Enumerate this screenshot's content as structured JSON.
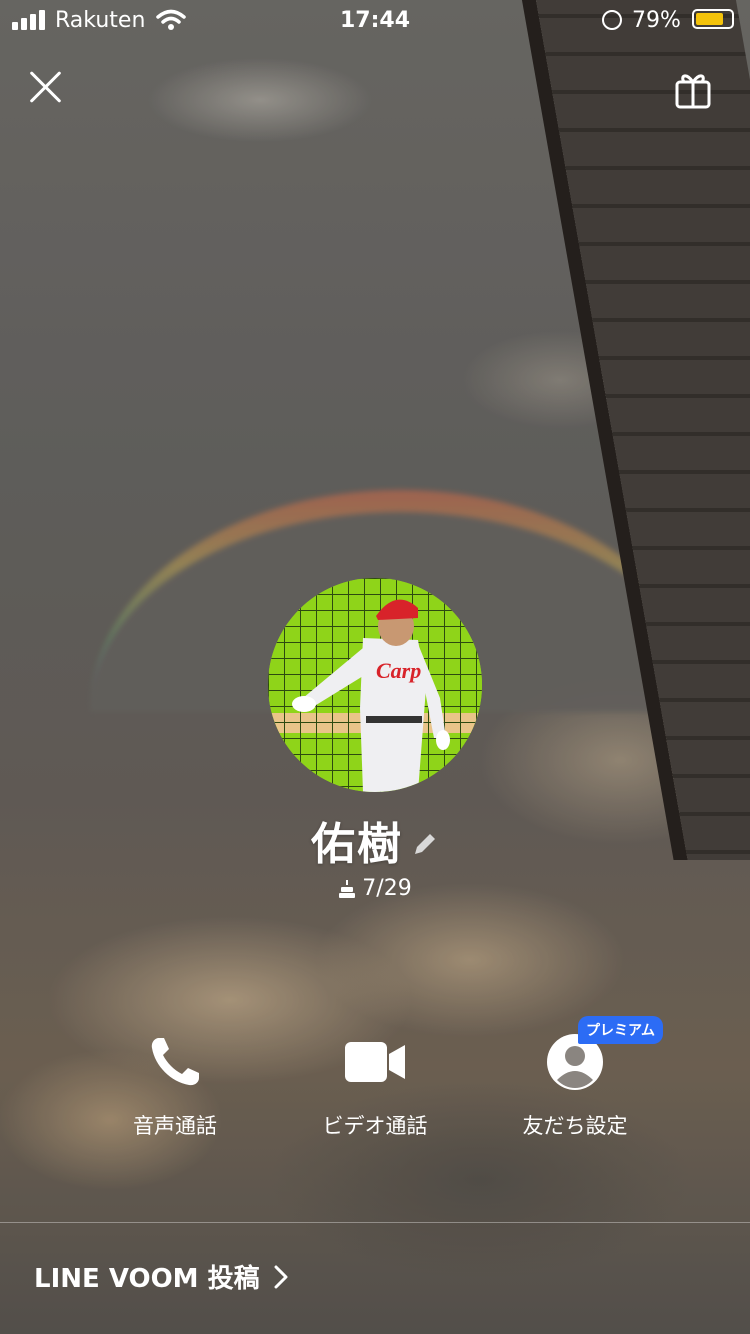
{
  "status_bar": {
    "carrier": "Rakuten",
    "time": "17:44",
    "battery": "79%",
    "battery_level": 0.79
  },
  "profile": {
    "name": "佑樹",
    "birthday": "7/29"
  },
  "actions": [
    {
      "label": "音声通話",
      "icon": "phone-icon"
    },
    {
      "label": "ビデオ通話",
      "icon": "video-camera-icon"
    },
    {
      "label": "友だち設定",
      "icon": "person-icon",
      "badge": "プレミアム"
    }
  ],
  "footer": {
    "voom_label": "LINE VOOM 投稿"
  },
  "colors": {
    "premium_badge": "#2c6cf5",
    "battery": "#f4c30b",
    "avatar_bg": "#8fd419",
    "uniform_red": "#d8232a"
  }
}
